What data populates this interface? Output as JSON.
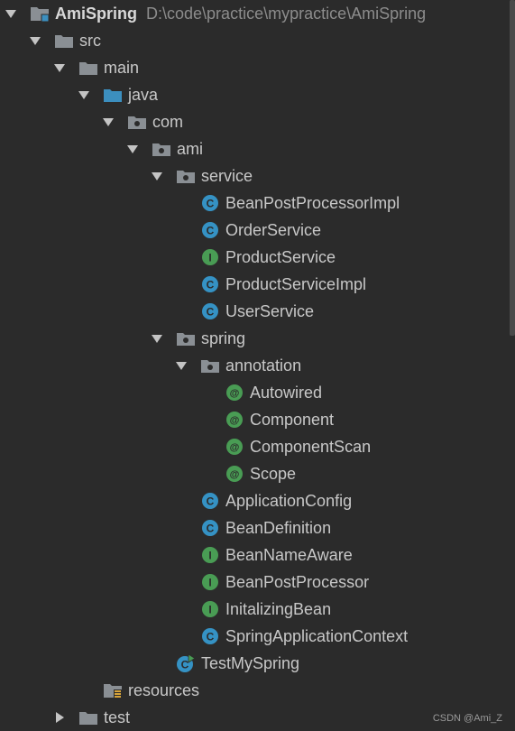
{
  "project": {
    "name": "AmiSpring",
    "path": "D:\\code\\practice\\mypractice\\AmiSpring"
  },
  "colors": {
    "background": "#2b2b2b",
    "text": "#c8c8c8",
    "folder_gray": "#8a8f94",
    "folder_blue": "#3c8fbf",
    "class_icon": "#3592c4",
    "interface_icon": "#499c54",
    "annotation_icon": "#499c54"
  },
  "tree": [
    {
      "label": "AmiSpring",
      "path": "D:\\code\\practice\\mypractice\\AmiSpring",
      "depth": 0,
      "expanded": true,
      "icon": "module-folder-icon",
      "bold": true
    },
    {
      "label": "src",
      "depth": 1,
      "expanded": true,
      "icon": "folder-icon"
    },
    {
      "label": "main",
      "depth": 2,
      "expanded": true,
      "icon": "folder-icon"
    },
    {
      "label": "java",
      "depth": 3,
      "expanded": true,
      "icon": "source-root-folder-icon"
    },
    {
      "label": "com",
      "depth": 4,
      "expanded": true,
      "icon": "package-icon"
    },
    {
      "label": "ami",
      "depth": 5,
      "expanded": true,
      "icon": "package-icon"
    },
    {
      "label": "service",
      "depth": 6,
      "expanded": true,
      "icon": "package-icon"
    },
    {
      "label": "BeanPostProcessorImpl",
      "depth": 7,
      "icon": "class-icon"
    },
    {
      "label": "OrderService",
      "depth": 7,
      "icon": "class-icon"
    },
    {
      "label": "ProductService",
      "depth": 7,
      "icon": "interface-icon"
    },
    {
      "label": "ProductServiceImpl",
      "depth": 7,
      "icon": "class-icon"
    },
    {
      "label": "UserService",
      "depth": 7,
      "icon": "class-icon"
    },
    {
      "label": "spring",
      "depth": 6,
      "expanded": true,
      "icon": "package-icon"
    },
    {
      "label": "annotation",
      "depth": 7,
      "expanded": true,
      "icon": "package-icon"
    },
    {
      "label": "Autowired",
      "depth": 8,
      "icon": "annotation-icon"
    },
    {
      "label": "Component",
      "depth": 8,
      "icon": "annotation-icon"
    },
    {
      "label": "ComponentScan",
      "depth": 8,
      "icon": "annotation-icon"
    },
    {
      "label": "Scope",
      "depth": 8,
      "icon": "annotation-icon"
    },
    {
      "label": "ApplicationConfig",
      "depth": 7,
      "icon": "class-icon"
    },
    {
      "label": "BeanDefinition",
      "depth": 7,
      "icon": "class-icon"
    },
    {
      "label": "BeanNameAware",
      "depth": 7,
      "icon": "interface-icon"
    },
    {
      "label": "BeanPostProcessor",
      "depth": 7,
      "icon": "interface-icon"
    },
    {
      "label": "InitalizingBean",
      "depth": 7,
      "icon": "interface-icon"
    },
    {
      "label": "SpringApplicationContext",
      "depth": 7,
      "icon": "class-icon"
    },
    {
      "label": "TestMySpring",
      "depth": 6,
      "icon": "runnable-class-icon"
    },
    {
      "label": "resources",
      "depth": 3,
      "icon": "resources-folder-icon"
    },
    {
      "label": "test",
      "depth": 2,
      "expanded": false,
      "icon": "folder-icon"
    }
  ],
  "watermark": "CSDN @Ami_Z"
}
